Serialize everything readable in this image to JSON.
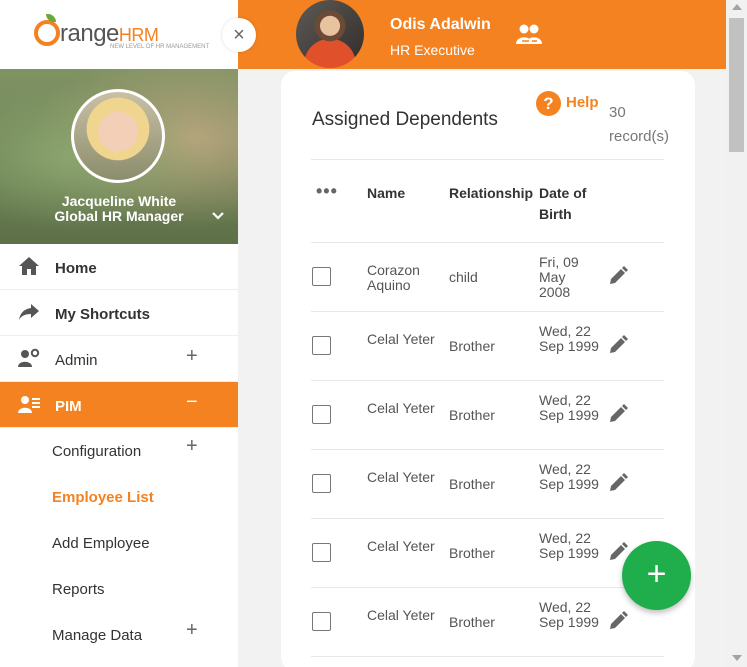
{
  "brand": {
    "logo_text_main": "range",
    "logo_text_accent": "HRM",
    "logo_tagline": "NEW LEVEL OF HR MANAGEMENT",
    "accent_color": "#f58220"
  },
  "topbar": {
    "user_name": "Odis Adalwin",
    "user_role": "HR Executive"
  },
  "sidebar": {
    "close_glyph": "×",
    "profile": {
      "name": "Jacqueline White",
      "title": "Global HR Manager"
    },
    "menu": [
      {
        "label": "Home",
        "icon": "home-icon"
      },
      {
        "label": "My Shortcuts",
        "icon": "share-arrow-icon"
      },
      {
        "label": "Admin",
        "icon": "admin-gear-icon",
        "expand": "+"
      },
      {
        "label": "PIM",
        "icon": "pim-icon",
        "expand": "−",
        "active": true
      }
    ],
    "submenu": [
      {
        "label": "Configuration",
        "expand": "+"
      },
      {
        "label": "Employee List",
        "current": true
      },
      {
        "label": "Add Employee"
      },
      {
        "label": "Reports"
      },
      {
        "label": "Manage Data",
        "expand": "+"
      }
    ]
  },
  "main": {
    "title": "Assigned Dependents",
    "help_icon": "?",
    "help_label": "Help",
    "records": "30 record(s)",
    "columns": {
      "options": "•••",
      "name": "Name",
      "relationship": "Relationship",
      "dob": "Date of Birth"
    },
    "rows": [
      {
        "name": "Corazon Aquino",
        "relationship": "child",
        "dob": "Fri, 09 May 2008"
      },
      {
        "name": "Celal Yeter",
        "relationship": "Brother",
        "dob": "Wed, 22 Sep 1999"
      },
      {
        "name": "Celal Yeter",
        "relationship": "Brother",
        "dob": "Wed, 22 Sep 1999"
      },
      {
        "name": "Celal Yeter",
        "relationship": "Brother",
        "dob": "Wed, 22 Sep 1999"
      },
      {
        "name": "Celal Yeter",
        "relationship": "Brother",
        "dob": "Wed, 22 Sep 1999"
      },
      {
        "name": "Celal Yeter",
        "relationship": "Brother",
        "dob": "Wed, 22 Sep 1999"
      }
    ],
    "fab_label": "+"
  }
}
